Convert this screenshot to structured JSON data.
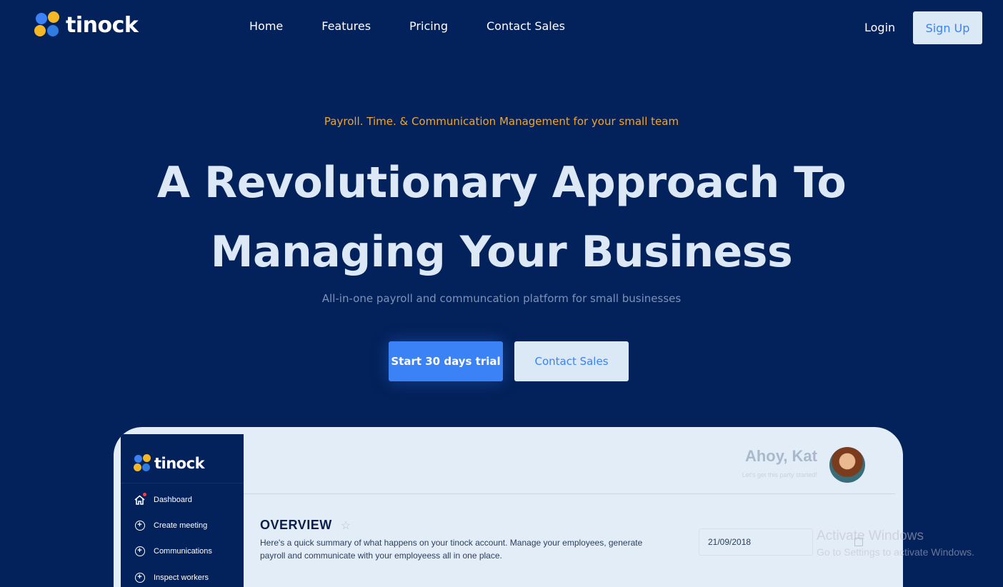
{
  "brand": {
    "name": "tinock",
    "logo_colors": [
      "#3b82f6",
      "#f5b724",
      "#2f7de1",
      "#f5b724"
    ]
  },
  "nav": {
    "links": [
      "Home",
      "Features",
      "Pricing",
      "Contact Sales"
    ],
    "login_label": "Login",
    "signup_label": "Sign Up"
  },
  "hero": {
    "eyebrow": "Payroll. Time. & Communication Management for your small team",
    "headline_line1": "A Revolutionary Approach To",
    "headline_line2": "Managing Your Business",
    "subline": "All-in-one payroll and communcation platform for small businesses",
    "cta_primary": "Start 30 days trial",
    "cta_secondary": "Contact Sales"
  },
  "dashboard_preview": {
    "brand": "tinock",
    "sidebar_items": [
      {
        "label": "Dashboard",
        "icon": "home-icon"
      },
      {
        "label": "Create meeting",
        "icon": "plus-circle-icon"
      },
      {
        "label": "Communications",
        "icon": "plus-circle-icon"
      },
      {
        "label": "Inspect workers",
        "icon": "plus-circle-icon"
      }
    ],
    "greeting": "Ahoy, Kat",
    "greeting_sub": "Let's get this party started!",
    "overview_title": "OVERVIEW",
    "overview_desc": "Here's a quick summary of what happens on your tinock account. Manage your employees, generate payroll and communicate with your employeess all in one place.",
    "date_value": "21/09/2018"
  },
  "watermark": {
    "line1": "Activate Windows",
    "line2": "Go to Settings to activate Windows."
  },
  "colors": {
    "background": "#03215a",
    "accent": "#3b82f6",
    "eyebrow": "#f5a524",
    "button_light": "#dbe8f6"
  }
}
